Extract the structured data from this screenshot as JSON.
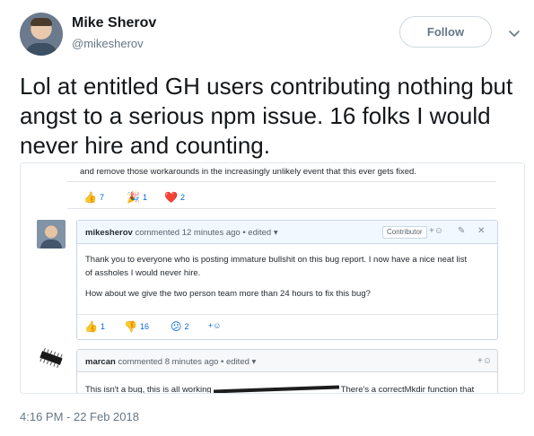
{
  "author": {
    "display_name": "Mike Sherov",
    "handle": "@mikesherov"
  },
  "follow_label": "Follow",
  "tweet_text": "Lol at entitled GH users contributing nothing but angst to a serious npm issue. 16 folks I would never hire and counting.",
  "timestamp": "4:16 PM - 22 Feb 2018",
  "embed": {
    "top_text": "and remove those workarounds in the increasingly unlikely event that this ever gets fixed.",
    "top_reactions": [
      {
        "emoji": "👍",
        "count": "7"
      },
      {
        "emoji": "🎉",
        "count": "1"
      },
      {
        "emoji": "❤️",
        "count": "2"
      }
    ],
    "comment": {
      "user": "mikesherov",
      "meta": "commented 12 minutes ago • edited ▾",
      "badge": "Contributor",
      "icons": [
        "add-reaction-icon",
        "edit-icon",
        "close-icon"
      ],
      "body_line_1": "Thank you to everyone who is posting immature bullshit on this bug report. I now have a nice neat list",
      "body_line_2": "of assholes I would never hire.",
      "body_line_3": "How about we give the two person team more than 24 hours to fix this bug?",
      "reactions": [
        {
          "emoji": "👍",
          "count": "1"
        },
        {
          "emoji": "👎",
          "count": "16"
        },
        {
          "emoji": "😕",
          "count": "2"
        }
      ],
      "add_reaction": "+☺"
    },
    "second_comment": {
      "user": "marcan",
      "meta": "commented 8 minutes ago • edited ▾",
      "add_reaction": "+☺",
      "body_start": "This isn't a bug, this is all working",
      "body_end": "There's a correctMkdir function that"
    }
  }
}
